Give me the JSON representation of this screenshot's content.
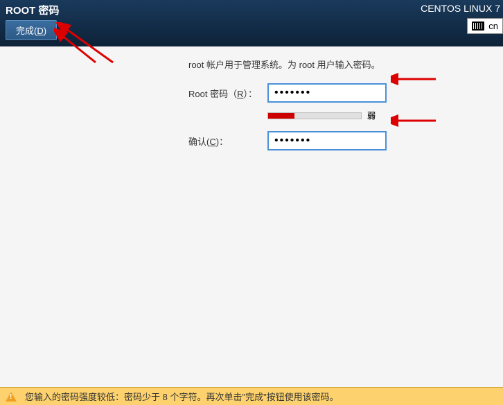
{
  "header": {
    "title": "ROOT 密码",
    "done_label_pre": "完成(",
    "done_label_key": "D",
    "done_label_post": ")",
    "distro": "CENTOS LINUX 7",
    "keyboard_layout": "cn"
  },
  "form": {
    "description": "root 帐户用于管理系统。为 root 用户输入密码。",
    "root_password_label_pre": "Root 密码（",
    "root_password_label_key": "R",
    "root_password_label_post": "）：",
    "root_password_value": "•••••••",
    "confirm_label_pre": "确认(",
    "confirm_label_key": "C",
    "confirm_label_post": ")：",
    "confirm_value": "•••••••",
    "strength_text": "弱",
    "strength_percent": 28
  },
  "warning": {
    "text": "您输入的密码强度较低：密码少于 8 个字符。再次单击\"完成\"按钮使用该密码。"
  }
}
